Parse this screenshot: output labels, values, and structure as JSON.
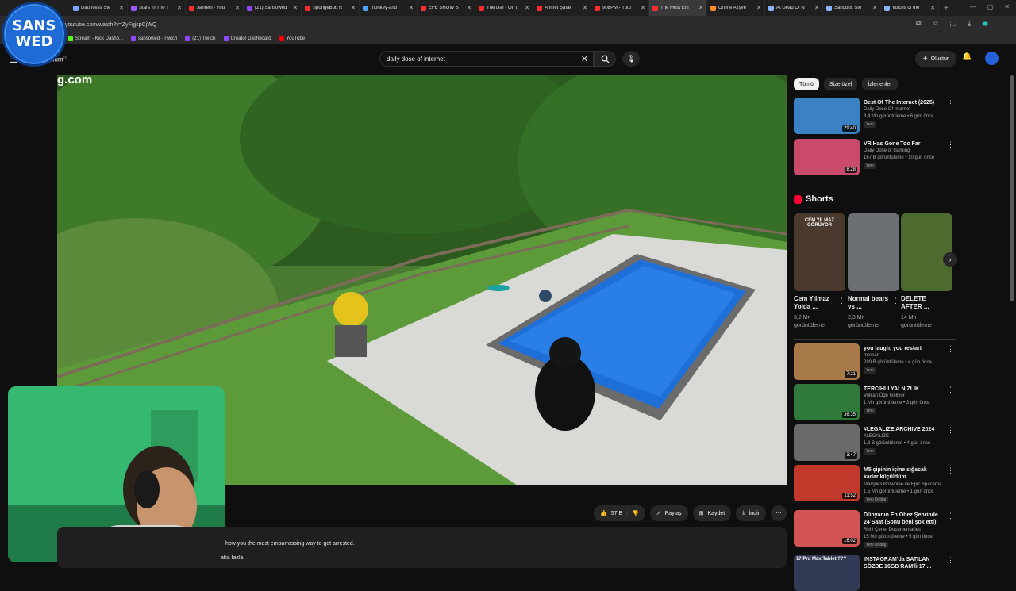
{
  "browser": {
    "tabs": [
      {
        "title": "Dauntless Ste",
        "color": "#7aa7ff"
      },
      {
        "title": "Stars In The T",
        "color": "#9b59ff"
      },
      {
        "title": "Jahrein - You",
        "color": "#ff2d2d"
      },
      {
        "title": "(21) Sansowed",
        "color": "#9146ff"
      },
      {
        "title": "SpongeBob R",
        "color": "#ff2d2d"
      },
      {
        "title": "monkey-and",
        "color": "#4aa3ff"
      },
      {
        "title": "EFE SHOW S",
        "color": "#ff2d2d"
      },
      {
        "title": "The Dæ - On t",
        "color": "#ff2d2d"
      },
      {
        "title": "Ahmet Şafak",
        "color": "#ff2d2d"
      },
      {
        "title": "908PM - Tutu",
        "color": "#ff2d2d"
      },
      {
        "title": "The Most Em",
        "color": "#ff2d2d",
        "active": true
      },
      {
        "title": "Online Alışve",
        "color": "#ff8c2d"
      },
      {
        "title": "At Dead Of N",
        "color": "#8ab4f8"
      },
      {
        "title": "Sandbox Ste",
        "color": "#8ab4f8"
      },
      {
        "title": "Voices of the",
        "color": "#8ab4f8"
      }
    ],
    "url": "youtube.com/watch?v=ZyFgjspCjWQ",
    "bookmarks": [
      {
        "label": "Stream - Kick Dashb...",
        "color": "#53fc18"
      },
      {
        "label": "sansowed - Twitch",
        "color": "#9146ff"
      },
      {
        "label": "(21) Twitch",
        "color": "#9146ff"
      },
      {
        "label": "Creator Dashboard",
        "color": "#9146ff"
      },
      {
        "label": "YouTube",
        "color": "#ff0000"
      }
    ]
  },
  "logo": {
    "line1": "SANS",
    "line2": "WED"
  },
  "header": {
    "brand": "mium",
    "search_value": "daily dose of internet",
    "create_label": "Oluştur"
  },
  "video": {
    "url_overlay": "g.com",
    "like_count": "57 B",
    "share_label": "Paylaş",
    "save_label": "Kaydet",
    "download_label": "İndir",
    "description_line1": "how you the most embarrassing way to get arrested.",
    "description_more": "aha fazla"
  },
  "sidebar": {
    "chips": [
      {
        "label": "Tümü",
        "active": true
      },
      {
        "label": "Size özel",
        "active": false
      },
      {
        "label": "İzlenenler",
        "active": false
      }
    ],
    "top_videos": [
      {
        "title": "Best Of The Internet (2025)",
        "channel": "Daily Dose Of Internet",
        "meta": "3,4 Mn görüntüleme • 6 gün önce",
        "badge": "Yeni",
        "duration": "29:40",
        "thumb": "#3b82c4"
      },
      {
        "title": "VR Has Gone Too Far",
        "channel": "Daily Dose of Gaming",
        "meta": "167 B görüntüleme • 10 gün önce",
        "badge": "Yeni",
        "duration": "8:28",
        "thumb": "#c94a6b"
      }
    ],
    "shorts_title": "Shorts",
    "shorts": [
      {
        "title": "Cem Yılmaz Yolda ...",
        "views": "3,2 Mn görüntüleme",
        "thumb": "#4a3a2e",
        "caption": "CEM YILMAZ GÖRÜYOR"
      },
      {
        "title": "Normal bears vs ...",
        "views": "2,3 Mn görüntüleme",
        "thumb": "#6c6f73",
        "caption": ""
      },
      {
        "title": "DELETE AFTER ...",
        "views": "14 Mn görüntüleme",
        "thumb": "#4d6b2f",
        "caption": ""
      }
    ],
    "videos": [
      {
        "title": "you laugh, you restart",
        "channel": "meman",
        "meta": "289 B görüntüleme • 4 gün önce",
        "badge": "Yeni",
        "duration": "7:21",
        "thumb": "#a87a4a"
      },
      {
        "title": "TERCİHLİ YALNIZLIK",
        "channel": "Volkan Öge Geliyor",
        "meta": "1 Mn görüntüleme • 3 gün önce",
        "badge": "Yeni",
        "duration": "36:35",
        "thumb": "#2f7a3a"
      },
      {
        "title": "#LEGALIZE ARCHIVE 2024",
        "channel": "#LEGALIZE",
        "meta": "1,8 B görüntüleme • 4 gün önce",
        "badge": "Yeni",
        "duration": "3:47",
        "thumb": "#6a6a6a"
      },
      {
        "title": "M5 çipinin içine sığacak kadar küçüldüm.",
        "channel": "Marques Brownlee ve Epic Spacema...",
        "meta": "1,5 Mn görüntüleme • 1 gün önce",
        "badge": "Yeni  Dublaj",
        "duration": "11:52",
        "thumb": "#c0392b"
      },
      {
        "title": "Dünyanın En Obez Şehrinde 24 Saat (Sonu beni şok etti)",
        "channel": "Ruhi Çenet Documentaries",
        "meta": "15 Mn görüntüleme • 5 gün önce",
        "badge": "Yeni  Dublaj",
        "duration": "16:02",
        "thumb": "#d35454"
      },
      {
        "title": "INSTAGRAM'da SATILAN SÖZDE 16GB RAM'li 17 ...",
        "channel": "",
        "meta": "",
        "badge": "",
        "duration": "",
        "thumb": "#333a55",
        "caption": "17 Pro Max Tablet ???"
      }
    ]
  },
  "colors": {
    "accent": "#ff0033",
    "bg": "#0f0f0f",
    "chip": "#272727"
  }
}
